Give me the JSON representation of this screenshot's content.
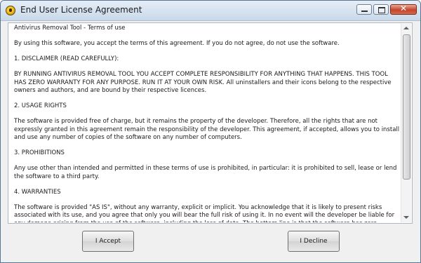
{
  "window": {
    "title": "End User License Agreement",
    "controls": {
      "minimize": "minimize",
      "maximize": "maximize",
      "close": "✕"
    }
  },
  "license": {
    "heading": "Antivirus Removal Tool - Terms of use",
    "intro": "By using this software, you accept the terms of this agreement. If you do not agree, do not use the software.",
    "section1_title": "1. DISCLAIMER (READ CAREFULLY):",
    "section1_body": "BY RUNNING ANTIVIRUS REMOVAL TOOL YOU ACCEPT COMPLETE RESPONSIBILITY FOR ANYTHING THAT HAPPENS. THIS TOOL HAS ZERO WARRANTY FOR ANY PURPOSE. RUN IT AT YOUR OWN RISK. All uninstallers and their icons belong to the respective owners and authors, and are bound by their respective licences.",
    "section2_title": "2. USAGE RIGHTS",
    "section2_body": "The software is provided free of charge, but it remains the property of the developer. Therefore, all the rights that are not expressly granted in this agreement remain the responsibility of the developer. This agreement, if accepted, allows you to install and use any number of copies of the software on any number of computers.",
    "section3_title": "3. PROHIBITIONS",
    "section3_body": "Any use other than intended and permitted in these terms of use is prohibited, in particular: it is prohibited to sell, lease or lend the software to a third party.",
    "section4_title": "4. WARRANTIES",
    "section4_body": "The software is provided \"AS IS\", without any warranty, explicit or implicit. You acknowledge that it is likely to present risks associated with its use, and you agree that only you will bear the full risk of using it. In no event will the developer be liable for any damage arising from the use of the software, including the loss of data. The bottom line is that the software has zero warranty for any purpose. Use it at your own risk."
  },
  "buttons": {
    "accept": "I Accept",
    "decline": "I Decline"
  }
}
